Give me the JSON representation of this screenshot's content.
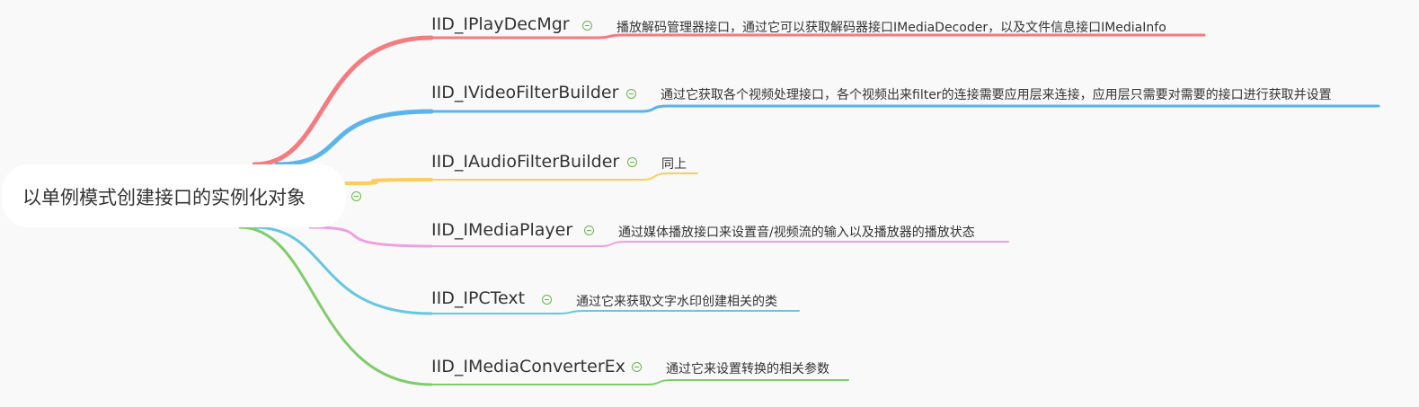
{
  "root": {
    "label": "以单例模式创建接口的实例化对象",
    "collapse_icon": "collapse-minus-icon"
  },
  "branches": [
    {
      "label": "IID_IPlayDecMgr",
      "note": "播放解码管理器接口，通过它可以获取解码器接口IMediaDecoder，以及文件信息接口IMediaInfo",
      "color": "#f47b7f",
      "collapse_icon": "collapse-minus-icon"
    },
    {
      "label": "IID_IVideoFilterBuilder",
      "note": "通过它获取各个视频处理接口，各个视频出来filter的连接需要应用层来连接，应用层只需要对需要的接口进行获取并设置",
      "color": "#5bb4ea",
      "collapse_icon": "collapse-minus-icon"
    },
    {
      "label": "IID_IAudioFilterBuilder",
      "note": "同上",
      "color": "#fccd5c",
      "collapse_icon": "collapse-minus-icon"
    },
    {
      "label": "IID_IMediaPlayer",
      "note": "通过媒体播放接口来设置音/视频流的输入以及播放器的播放状态",
      "color": "#ef9fe0",
      "collapse_icon": "collapse-minus-icon"
    },
    {
      "label": "IID_IPCText",
      "note": "通过它来获取文字水印创建相关的类",
      "color": "#66c7e3",
      "collapse_icon": "collapse-minus-icon"
    },
    {
      "label": "IID_IMediaConverterEx",
      "note": "通过它来设置转换的相关参数",
      "color": "#80cc6b",
      "collapse_icon": "collapse-minus-icon"
    }
  ]
}
